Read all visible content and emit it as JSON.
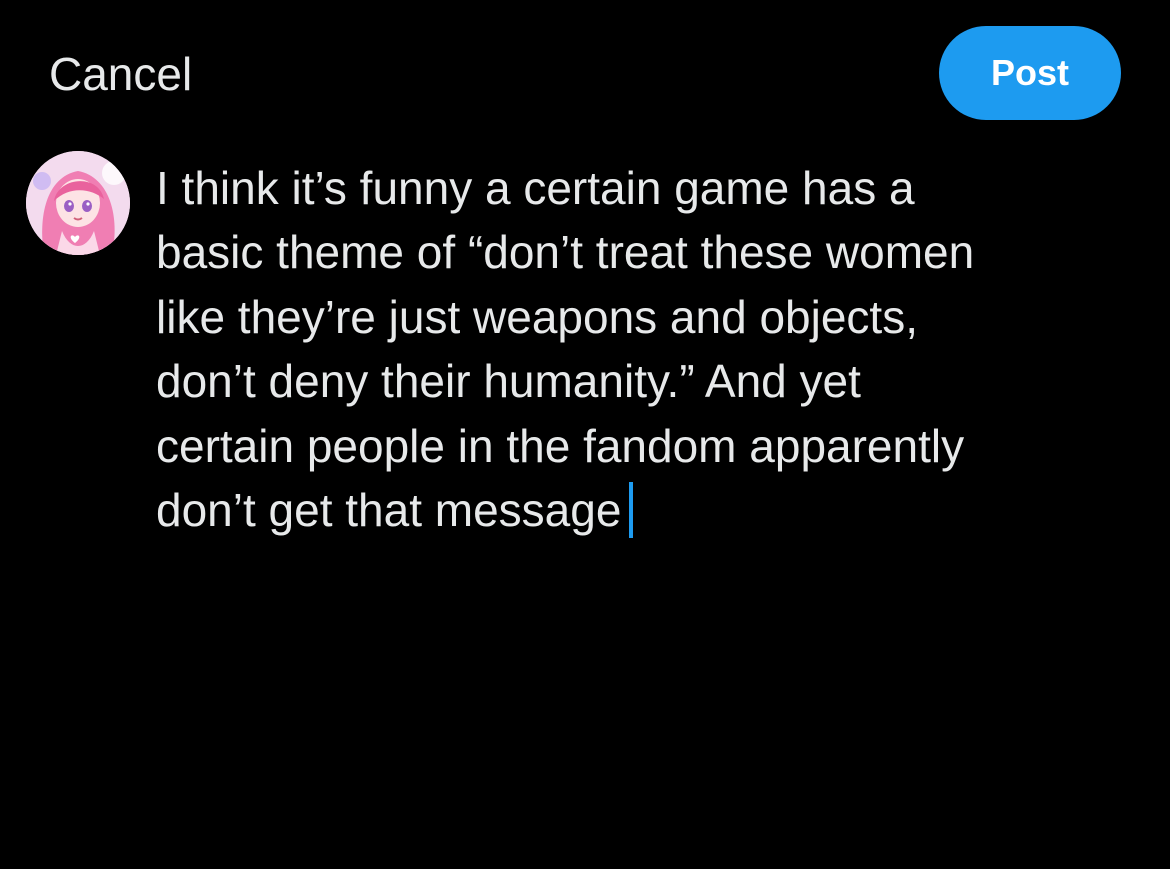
{
  "header": {
    "cancel_label": "Cancel",
    "post_label": "Post"
  },
  "colors": {
    "background": "#000000",
    "text": "#e7e9ea",
    "accent": "#1d9bf0"
  },
  "avatar": {
    "icon": "user-avatar"
  },
  "composer": {
    "lines": [
      "I think it’s funny a certain game has a",
      "basic theme of “don’t treat these women",
      "like they’re just weapons and objects,",
      "don’t deny their humanity.” And yet",
      "certain people in the fandom apparently",
      "don’t get that message"
    ]
  }
}
